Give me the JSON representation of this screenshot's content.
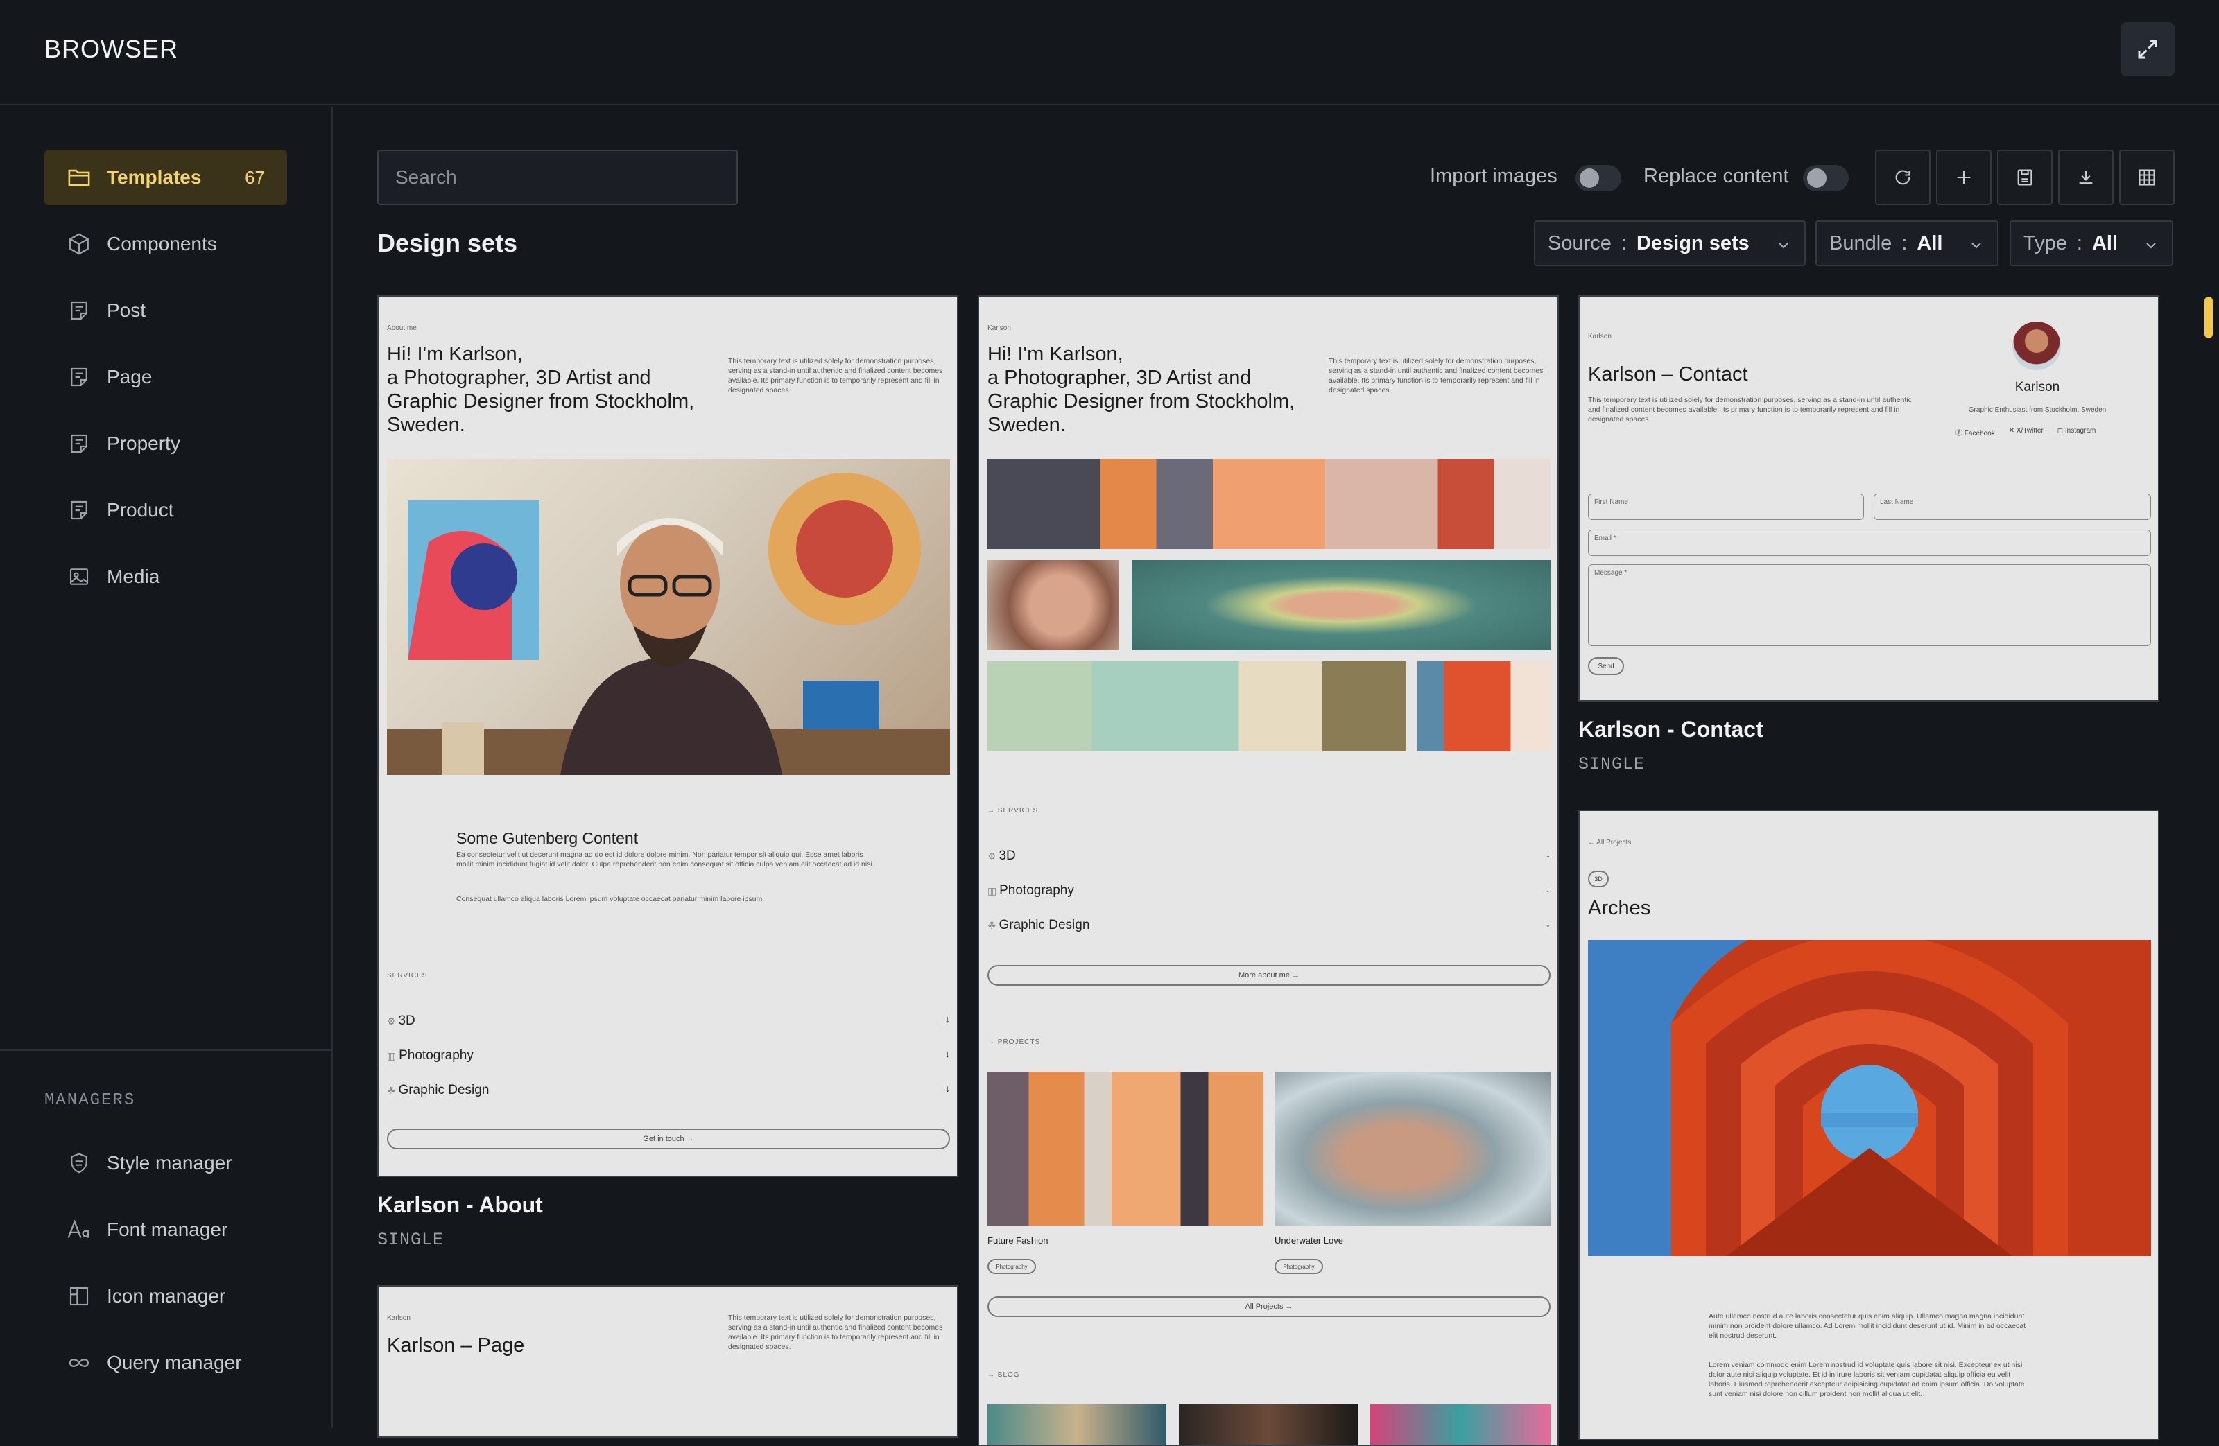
{
  "app": {
    "title": "BROWSER"
  },
  "sidebar": {
    "items": [
      {
        "label": "Templates",
        "badge": "67",
        "icon": "folder-icon",
        "active": true
      },
      {
        "label": "Components",
        "icon": "cube-icon"
      },
      {
        "label": "Post",
        "icon": "document-icon"
      },
      {
        "label": "Page",
        "icon": "document-icon"
      },
      {
        "label": "Property",
        "icon": "document-icon"
      },
      {
        "label": "Product",
        "icon": "document-icon"
      },
      {
        "label": "Media",
        "icon": "image-icon"
      }
    ],
    "managers_title": "MANAGERS",
    "managers": [
      {
        "label": "Style manager",
        "icon": "shield-icon"
      },
      {
        "label": "Font manager",
        "icon": "font-icon"
      },
      {
        "label": "Icon manager",
        "icon": "grid-icon"
      },
      {
        "label": "Query manager",
        "icon": "infinity-icon"
      }
    ]
  },
  "toolbar": {
    "search_placeholder": "Search",
    "import_images_label": "Import images",
    "import_images_on": false,
    "replace_content_label": "Replace content",
    "replace_content_on": false,
    "buttons": [
      "refresh-icon",
      "plus-icon",
      "save-icon",
      "download-icon",
      "grid-icon"
    ]
  },
  "section_title": "Design sets",
  "filters": [
    {
      "label": "Source",
      "value": "Design sets"
    },
    {
      "label": "Bundle",
      "value": "All"
    },
    {
      "label": "Type",
      "value": "All"
    }
  ],
  "cards": {
    "about": {
      "title": "Karlson - About",
      "type": "SINGLE",
      "kicker": "About me",
      "heading": "Hi! I'm Karlson,\na Photographer, 3D Artist and\nGraphic Designer from Stockholm,\nSweden.",
      "blurb": "This temporary text is utilized solely for demonstration purposes, serving as a stand-in until authentic and finalized content becomes available. Its primary function is to temporarily represent and fill in designated spaces.",
      "content_title": "Some Gutenberg Content",
      "content_p1": "Ea consectetur velit ut deserunt magna ad do est id dolore dolore minim. Non pariatur tempor sit aliquip qui. Esse amet laboris mollit minim incididunt fugiat id velit dolor. Culpa reprehenderit non enim consequat sit officia culpa veniam elit occaecat ad id nisi.",
      "content_p2": "Consequat ullamco aliqua laboris Lorem ipsum voluptate occaecat pariatur minim labore ipsum.",
      "services_label": "SERVICES",
      "services": [
        "3D",
        "Photography",
        "Graphic Design"
      ],
      "cta": "Get in touch"
    },
    "home": {
      "kicker": "Karlson",
      "heading": "Hi! I'm Karlson,\na Photographer, 3D Artist and\nGraphic Designer from Stockholm,\nSweden.",
      "blurb": "This temporary text is utilized solely for demonstration purposes, serving as a stand-in until authentic and finalized content becomes available. Its primary function is to temporarily represent and fill in designated spaces.",
      "services_label": "SERVICES",
      "services": [
        "3D",
        "Photography",
        "Graphic Design"
      ],
      "more_btn": "More about me",
      "projects_label": "PROJECTS",
      "projects": [
        {
          "name": "Future Fashion",
          "tag": "Photography"
        },
        {
          "name": "Underwater Love",
          "tag": "Photography"
        }
      ],
      "all_projects_btn": "All Projects",
      "blog_label": "BLOG"
    },
    "contact": {
      "title": "Karlson - Contact",
      "type": "SINGLE",
      "kicker": "Karlson",
      "heading": "Karlson – Contact",
      "blurb": "This temporary text is utilized solely for demonstration purposes, serving as a stand-in until authentic and finalized content becomes available. Its primary function is to temporarily represent and fill in designated spaces.",
      "profile_name": "Karlson",
      "profile_sub": "Graphic Enthusiast from Stockholm, Sweden",
      "socials": [
        "Facebook",
        "X/Twitter",
        "Instagram"
      ],
      "fields": {
        "first": "First Name",
        "last": "Last Name",
        "email": "Email *",
        "message": "Message *"
      },
      "send": "Send"
    },
    "arches": {
      "back_link": "All Projects",
      "tag": "3D",
      "heading": "Arches",
      "p1": "Aute ullamco nostrud aute laboris consectetur quis enim aliquip. Ullamco magna magna incididunt minim non proident dolore ullamco. Ad Lorem mollit incididunt deserunt ut id. Minim in ad occaecat elit nostrud deserunt.",
      "p2": "Lorem veniam commodo enim Lorem nostrud id voluptate quis labore sit nisi. Excepteur ex ut nisi dolor aute nisi aliquip voluptate. Et id in irure laboris sit veniam cupidatat aliquip officia eu velit laboris. Eiusmod reprehenderit excepteur adipisicing cupidatat ad enim ipsum officia. Do voluptate sunt veniam nisi dolore non cillum proident non mollit aliqua ut elit."
    },
    "page": {
      "kicker": "Karlson",
      "heading": "Karlson – Page",
      "blurb": "This temporary text is utilized solely for demonstration purposes, serving as a stand-in until authentic and finalized content becomes available. Its primary function is to temporarily represent and fill in designated spaces."
    }
  },
  "colors": {
    "accent": "#f3d36c",
    "background": "#14171c",
    "card_bg": "#e6e6e6"
  }
}
